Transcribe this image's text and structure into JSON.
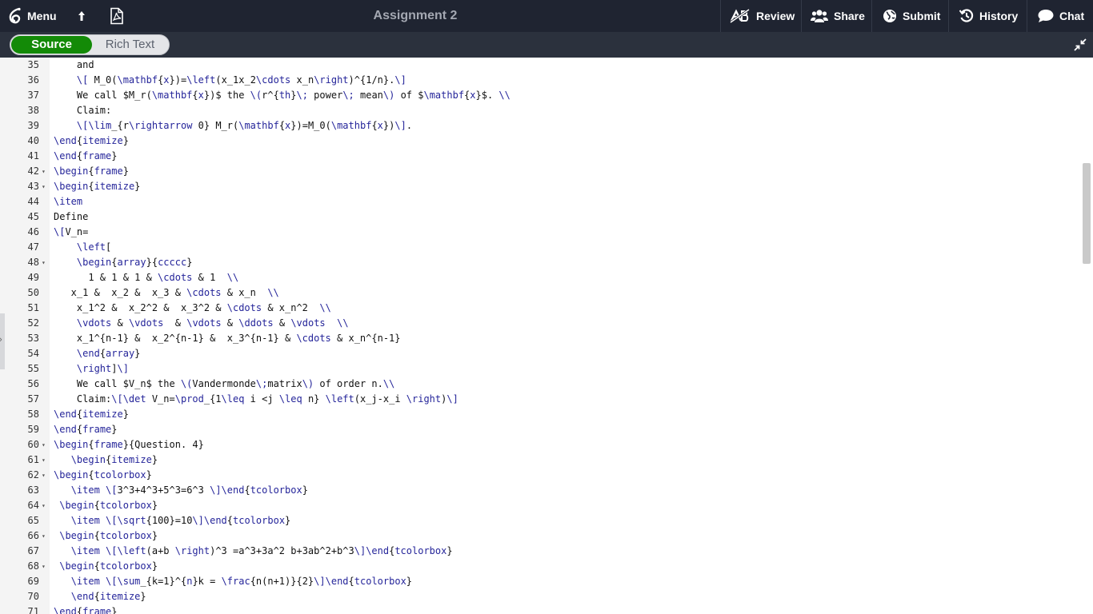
{
  "topbar": {
    "menu_label": "Menu",
    "title": "Assignment 2",
    "review_label": "Review",
    "share_label": "Share",
    "submit_label": "Submit",
    "history_label": "History",
    "chat_label": "Chat"
  },
  "toolbar": {
    "source_label": "Source",
    "rich_text_label": "Rich Text"
  },
  "editor": {
    "lines": [
      {
        "n": "35",
        "fold": false,
        "text": "    and"
      },
      {
        "n": "36",
        "fold": false,
        "text": "    \\[ M_0(\\mathbf{x})=\\left(x_1x_2\\cdots x_n\\right)^{1/n}.\\]"
      },
      {
        "n": "37",
        "fold": false,
        "text": "    We call $M_r(\\mathbf{x})$ the \\(r^{th}\\; power\\; mean\\) of $\\mathbf{x}$. \\\\"
      },
      {
        "n": "38",
        "fold": false,
        "text": "    Claim:"
      },
      {
        "n": "39",
        "fold": false,
        "text": "    \\[\\lim_{r\\rightarrow 0} M_r(\\mathbf{x})=M_0(\\mathbf{x})\\]."
      },
      {
        "n": "40",
        "fold": false,
        "text": "\\end{itemize}"
      },
      {
        "n": "41",
        "fold": false,
        "text": "\\end{frame}"
      },
      {
        "n": "42",
        "fold": true,
        "text": "\\begin{frame}"
      },
      {
        "n": "43",
        "fold": true,
        "text": "\\begin{itemize}"
      },
      {
        "n": "44",
        "fold": false,
        "text": "\\item"
      },
      {
        "n": "45",
        "fold": false,
        "text": "Define"
      },
      {
        "n": "46",
        "fold": false,
        "text": "\\[V_n="
      },
      {
        "n": "47",
        "fold": false,
        "text": "    \\left["
      },
      {
        "n": "48",
        "fold": true,
        "text": "    \\begin{array}{ccccc}"
      },
      {
        "n": "49",
        "fold": false,
        "text": "      1 & 1 & 1 & \\cdots & 1  \\\\"
      },
      {
        "n": "50",
        "fold": false,
        "text": "   x_1 &  x_2 &  x_3 & \\cdots & x_n  \\\\"
      },
      {
        "n": "51",
        "fold": false,
        "text": "    x_1^2 &  x_2^2 &  x_3^2 & \\cdots & x_n^2  \\\\"
      },
      {
        "n": "52",
        "fold": false,
        "text": "    \\vdots & \\vdots  & \\vdots & \\ddots & \\vdots  \\\\"
      },
      {
        "n": "53",
        "fold": false,
        "text": "    x_1^{n-1} &  x_2^{n-1} &  x_3^{n-1} & \\cdots & x_n^{n-1}"
      },
      {
        "n": "54",
        "fold": false,
        "text": "    \\end{array}"
      },
      {
        "n": "55",
        "fold": false,
        "text": "    \\right]\\]"
      },
      {
        "n": "56",
        "fold": false,
        "text": "    We call $V_n$ the \\(Vandermonde\\;matrix\\) of order n.\\\\"
      },
      {
        "n": "57",
        "fold": false,
        "text": "    Claim:\\[\\det V_n=\\prod_{1\\leq i <j \\leq n} \\left(x_j-x_i \\right)\\]"
      },
      {
        "n": "58",
        "fold": false,
        "text": "\\end{itemize}"
      },
      {
        "n": "59",
        "fold": false,
        "text": "\\end{frame}"
      },
      {
        "n": "60",
        "fold": true,
        "text": "\\begin{frame}{Question. 4}"
      },
      {
        "n": "61",
        "fold": true,
        "text": "   \\begin{itemize}"
      },
      {
        "n": "62",
        "fold": true,
        "text": "\\begin{tcolorbox}"
      },
      {
        "n": "63",
        "fold": false,
        "text": "   \\item \\[3^3+4^3+5^3=6^3 \\]\\end{tcolorbox}"
      },
      {
        "n": "64",
        "fold": true,
        "text": " \\begin{tcolorbox}"
      },
      {
        "n": "65",
        "fold": false,
        "text": "   \\item \\[\\sqrt{100}=10\\]\\end{tcolorbox}"
      },
      {
        "n": "66",
        "fold": true,
        "text": " \\begin{tcolorbox}"
      },
      {
        "n": "67",
        "fold": false,
        "text": "   \\item \\[\\left(a+b \\right)^3 =a^3+3a^2 b+3ab^2+b^3\\]\\end{tcolorbox}"
      },
      {
        "n": "68",
        "fold": true,
        "text": " \\begin{tcolorbox}"
      },
      {
        "n": "69",
        "fold": false,
        "text": "   \\item \\[\\sum_{k=1}^{n}k = \\frac{n(n+1)}{2}\\]\\end{tcolorbox}"
      },
      {
        "n": "70",
        "fold": false,
        "text": "   \\end{itemize}"
      },
      {
        "n": "71",
        "fold": false,
        "text": "\\end{frame}"
      }
    ]
  },
  "colors": {
    "topbar_bg": "#1f2431",
    "toolbar_bg": "#2b313d",
    "source_active": "#138a07",
    "gutter_bg": "#f4f4f4",
    "command": "#25259a",
    "math": "#8a1e1e",
    "spell_squiggle": "#e03a2f"
  },
  "icons": {
    "menu": "overleaf-logo-icon",
    "upload": "upload-arrow-icon",
    "pdf": "pdf-file-icon",
    "review": "track-changes-icon",
    "share": "users-icon",
    "submit": "globe-icon",
    "history": "history-icon",
    "chat": "chat-bubble-icon",
    "collapse": "collapse-arrows-icon"
  }
}
